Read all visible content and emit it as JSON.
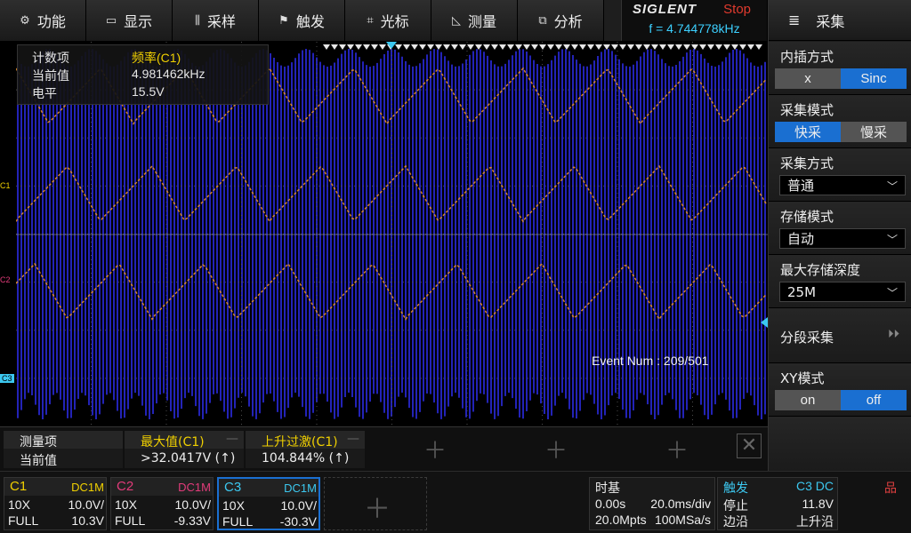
{
  "menu": [
    {
      "label": "功能",
      "icon": "gear-icon",
      "glyph": "⚙"
    },
    {
      "label": "显示",
      "icon": "monitor-icon",
      "glyph": "▭"
    },
    {
      "label": "采样",
      "icon": "sampling-icon",
      "glyph": "⫼"
    },
    {
      "label": "触发",
      "icon": "flag-icon",
      "glyph": "⚑"
    },
    {
      "label": "光标",
      "icon": "cursor-icon",
      "glyph": "⌗"
    },
    {
      "label": "测量",
      "icon": "ruler-icon",
      "glyph": "◺"
    },
    {
      "label": "分析",
      "icon": "analysis-icon",
      "glyph": "⧉"
    }
  ],
  "brand": {
    "logo": "SIGLENT",
    "state": "Stop",
    "freq": "f = 4.744778kHz"
  },
  "counter": {
    "rows": [
      {
        "k": "计数项",
        "v": "频率(C1)"
      },
      {
        "k": "当前值",
        "v": "4.981462kHz"
      },
      {
        "k": "电平",
        "v": "15.5V"
      }
    ]
  },
  "event_num": "Event Num : 209/501",
  "channel_markers": {
    "c1": "C1",
    "c2": "C2",
    "c3": "C3"
  },
  "right_panel": {
    "title": "采集",
    "title_icon": "list-icon",
    "interp": {
      "label": "内插方式",
      "a": "x",
      "b": "Sinc",
      "selected": "b"
    },
    "acq_mode": {
      "label": "采集模式",
      "a": "快采",
      "b": "慢采",
      "selected": "a"
    },
    "acq_method": {
      "label": "采集方式",
      "value": "普通"
    },
    "mem_mode": {
      "label": "存储模式",
      "value": "自动"
    },
    "mem_depth": {
      "label": "最大存储深度",
      "value": "25M"
    },
    "segmented": {
      "label": "分段采集",
      "icon": "play-arrow-icon"
    },
    "xy": {
      "label": "XY模式",
      "a": "on",
      "b": "off",
      "selected": "b"
    }
  },
  "measure": {
    "header_label": "测量项",
    "current_label": "当前值",
    "m1_name": "最大值(C1)",
    "m1_value": ">32.0417V (↑)",
    "m2_name": "上升过激(C1)",
    "m2_value": "104.844% (↑)"
  },
  "channels": {
    "c1": {
      "name": "C1",
      "coupling": "DC1M",
      "probe": "10X",
      "scale": "10.0V/",
      "bw": "FULL",
      "offset": "10.3V"
    },
    "c2": {
      "name": "C2",
      "coupling": "DC1M",
      "probe": "10X",
      "scale": "10.0V/",
      "bw": "FULL",
      "offset": "-9.33V"
    },
    "c3": {
      "name": "C3",
      "coupling": "DC1M",
      "probe": "10X",
      "scale": "10.0V/",
      "bw": "FULL",
      "offset": "-30.3V"
    }
  },
  "timebase": {
    "label": "时基",
    "delay": "0.00s",
    "scale": "20.0ms/div",
    "points": "20.0Mpts",
    "rate": "100MSa/s"
  },
  "trigger": {
    "label": "触发",
    "source": "C3 DC",
    "state": "停止",
    "level": "11.8V",
    "type_label": "边沿",
    "slope": "上升沿"
  },
  "colors": {
    "c1": "#f0d000",
    "c2": "#e23b7a",
    "c3": "#3cc8f0",
    "accent": "#1a6fd1",
    "stop": "#e03a2e"
  }
}
